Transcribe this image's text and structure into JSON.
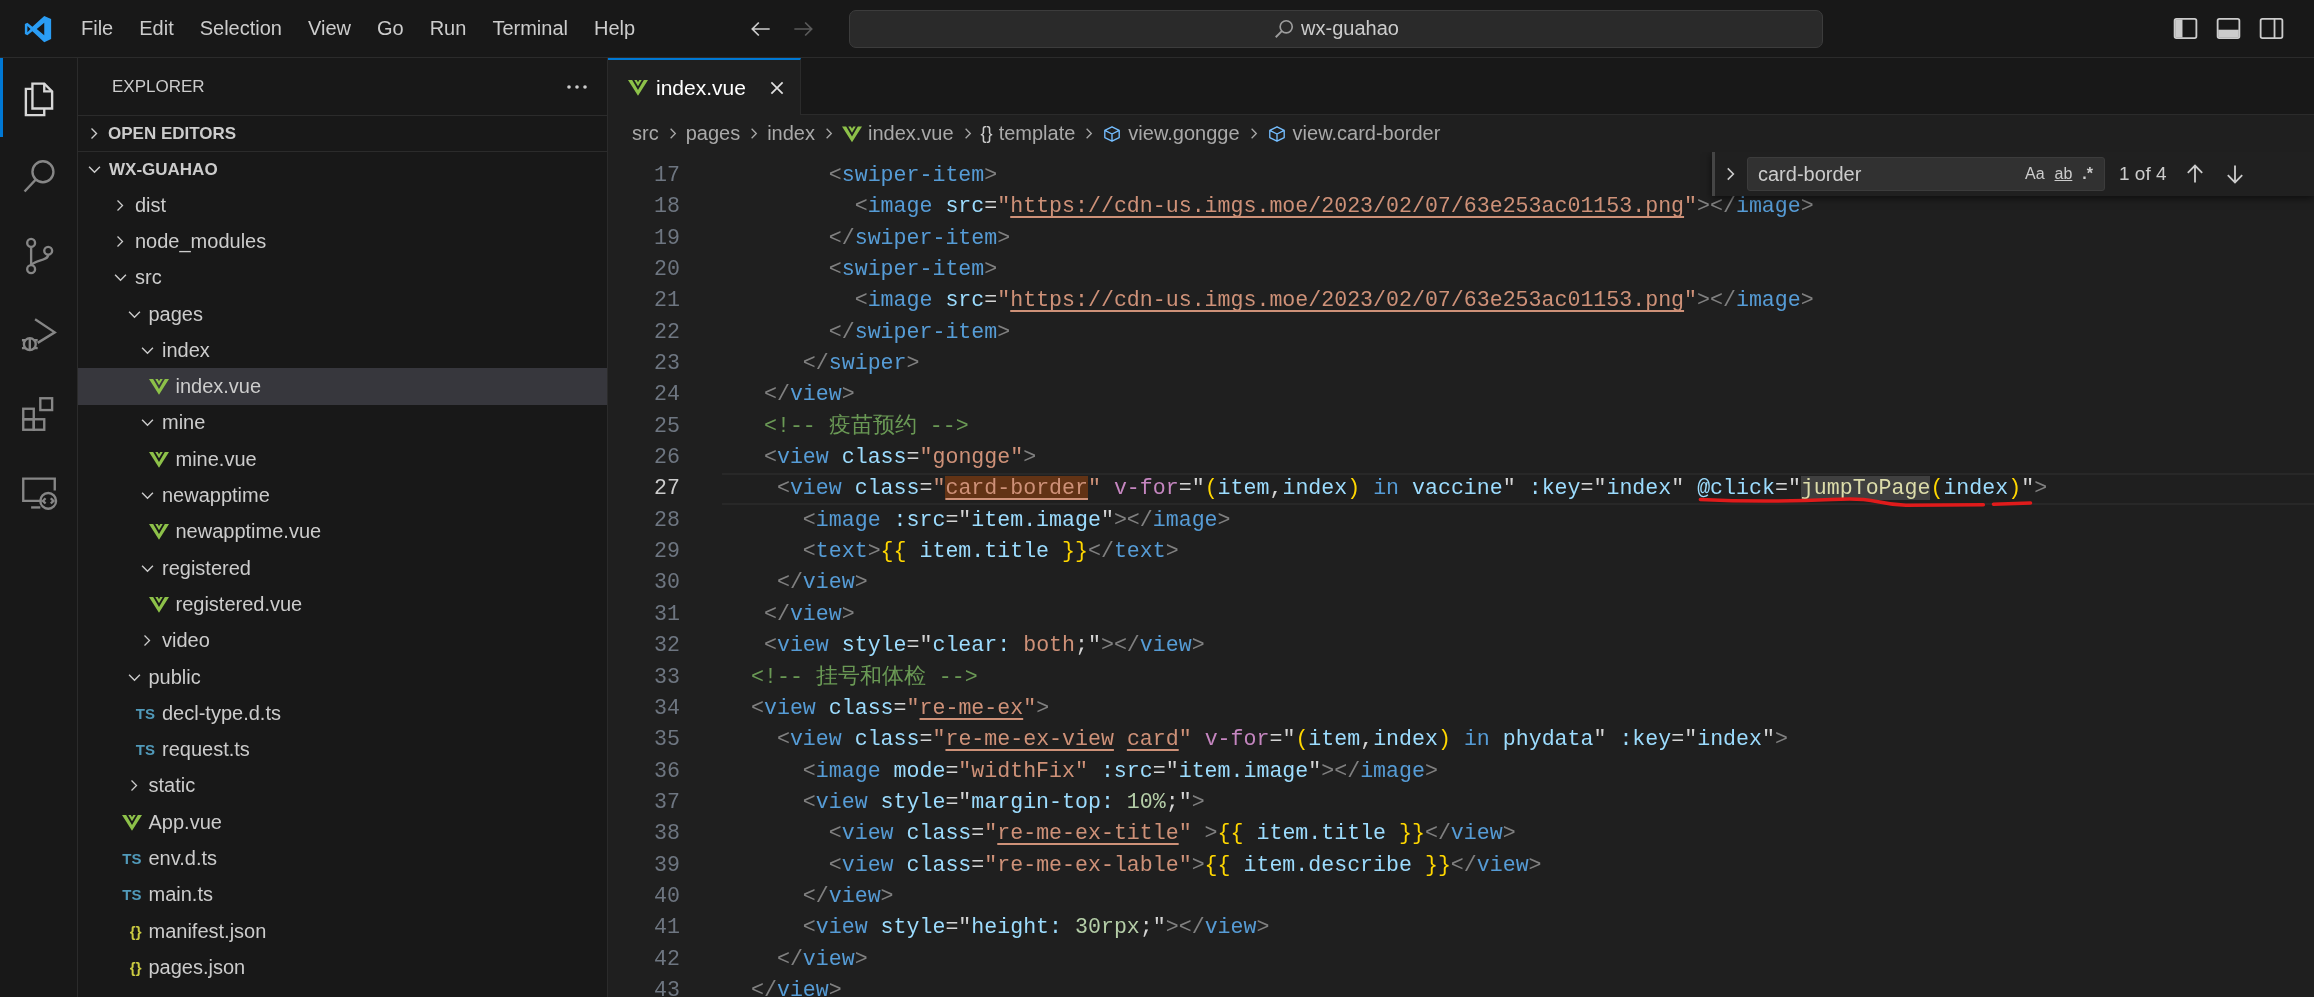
{
  "title_bar": {
    "menu": [
      "File",
      "Edit",
      "Selection",
      "View",
      "Go",
      "Run",
      "Terminal",
      "Help"
    ],
    "nav": [
      {
        "kind": "back",
        "disabled": false
      },
      {
        "kind": "forward",
        "disabled": true
      }
    ],
    "command_center": "wx-guahao",
    "layout": [
      {
        "kind": "primary-sidebar",
        "on": true
      },
      {
        "kind": "panel",
        "on": true
      },
      {
        "kind": "secondary-sidebar",
        "on": false
      }
    ]
  },
  "activity_bar": [
    {
      "kind": "files",
      "selected": true
    },
    {
      "kind": "search",
      "selected": false
    },
    {
      "kind": "source-control",
      "selected": false
    },
    {
      "kind": "run-debug",
      "selected": false
    },
    {
      "kind": "extensions",
      "selected": false
    },
    {
      "kind": "remote",
      "selected": false
    }
  ],
  "explorer": {
    "title": "EXPLORER",
    "sections": [
      {
        "title": "OPEN EDITORS",
        "expanded": false
      },
      {
        "title": "WX-GUAHAO",
        "expanded": true,
        "children": [
          {
            "name": "dist",
            "kind": "folder",
            "expanded": false,
            "selected": false
          },
          {
            "name": "node_modules",
            "kind": "folder",
            "expanded": false,
            "selected": false
          },
          {
            "name": "src",
            "kind": "folder",
            "expanded": true,
            "selected": false,
            "children": [
              {
                "name": "pages",
                "kind": "folder",
                "expanded": true,
                "selected": false,
                "children": [
                  {
                    "name": "index",
                    "kind": "folder",
                    "expanded": true,
                    "selected": false,
                    "children": [
                      {
                        "name": "index.vue",
                        "kind": "vue",
                        "selected": true
                      }
                    ]
                  },
                  {
                    "name": "mine",
                    "kind": "folder",
                    "expanded": true,
                    "selected": false,
                    "children": [
                      {
                        "name": "mine.vue",
                        "kind": "vue",
                        "selected": false
                      }
                    ]
                  },
                  {
                    "name": "newapptime",
                    "kind": "folder",
                    "expanded": true,
                    "selected": false,
                    "children": [
                      {
                        "name": "newapptime.vue",
                        "kind": "vue",
                        "selected": false
                      }
                    ]
                  },
                  {
                    "name": "registered",
                    "kind": "folder",
                    "expanded": true,
                    "selected": false,
                    "children": [
                      {
                        "name": "registered.vue",
                        "kind": "vue",
                        "selected": false
                      }
                    ]
                  },
                  {
                    "name": "video",
                    "kind": "folder",
                    "expanded": false,
                    "selected": false
                  }
                ]
              },
              {
                "name": "public",
                "kind": "folder",
                "expanded": true,
                "selected": false,
                "children": [
                  {
                    "name": "decl-type.d.ts",
                    "kind": "ts",
                    "badge": "TS",
                    "selected": false
                  },
                  {
                    "name": "request.ts",
                    "kind": "ts",
                    "badge": "TS",
                    "selected": false
                  }
                ]
              },
              {
                "name": "static",
                "kind": "folder",
                "expanded": false,
                "selected": false
              },
              {
                "name": "App.vue",
                "kind": "vue",
                "selected": false
              },
              {
                "name": "env.d.ts",
                "kind": "ts",
                "badge": "TS",
                "selected": false
              },
              {
                "name": "main.ts",
                "kind": "ts",
                "badge": "TS",
                "selected": false
              },
              {
                "name": "manifest.json",
                "kind": "json",
                "badge": "{}",
                "selected": false
              },
              {
                "name": "pages.json",
                "kind": "json",
                "badge": "{}",
                "selected": false
              }
            ]
          }
        ]
      }
    ]
  },
  "tabs": [
    {
      "title": "index.vue",
      "kind": "vue",
      "selected": true
    }
  ],
  "breadcrumbs": [
    {
      "text": "src",
      "kind": "folder"
    },
    {
      "text": "pages",
      "kind": "folder"
    },
    {
      "text": "index",
      "kind": "folder"
    },
    {
      "text": "index.vue",
      "kind": "vue"
    },
    {
      "text": "template",
      "kind": "braces",
      "badge": "{}"
    },
    {
      "text": "view.gongge",
      "kind": "element"
    },
    {
      "text": "view.card-border",
      "kind": "element"
    }
  ],
  "find": {
    "replace_expanded": false,
    "value": "card-border",
    "options": [
      {
        "kind": "case",
        "label": "Aa",
        "on": false
      },
      {
        "kind": "word",
        "label": "ab",
        "on": false
      },
      {
        "kind": "regex",
        "label": ".*",
        "on": false
      }
    ],
    "count": "1 of 4"
  },
  "code": {
    "lines": [
      {
        "number": "17",
        "current": false,
        "tokens": [
          {
            "kind": "punct",
            "text": "      <"
          },
          {
            "kind": "tag",
            "text": "swiper-item"
          },
          {
            "kind": "punct",
            "text": ">"
          }
        ]
      },
      {
        "number": "18",
        "current": false,
        "tokens": [
          {
            "kind": "punct",
            "text": "        <"
          },
          {
            "kind": "tag",
            "text": "image"
          },
          {
            "kind": "attr",
            "text": " src"
          },
          {
            "kind": "op",
            "text": "="
          },
          {
            "kind": "str",
            "text": "\""
          },
          {
            "kind": "str",
            "text": "https://cdn-us.imgs.moe/2023/02/07/63e253ac01153.png",
            "underlined": true
          },
          {
            "kind": "str",
            "text": "\""
          },
          {
            "kind": "punct",
            "text": "></"
          },
          {
            "kind": "tag",
            "text": "image"
          },
          {
            "kind": "punct",
            "text": ">"
          }
        ]
      },
      {
        "number": "19",
        "current": false,
        "tokens": [
          {
            "kind": "punct",
            "text": "      </"
          },
          {
            "kind": "tag",
            "text": "swiper-item"
          },
          {
            "kind": "punct",
            "text": ">"
          }
        ]
      },
      {
        "number": "20",
        "current": false,
        "tokens": [
          {
            "kind": "punct",
            "text": "      <"
          },
          {
            "kind": "tag",
            "text": "swiper-item"
          },
          {
            "kind": "punct",
            "text": ">"
          }
        ]
      },
      {
        "number": "21",
        "current": false,
        "tokens": [
          {
            "kind": "punct",
            "text": "        <"
          },
          {
            "kind": "tag",
            "text": "image"
          },
          {
            "kind": "attr",
            "text": " src"
          },
          {
            "kind": "op",
            "text": "="
          },
          {
            "kind": "str",
            "text": "\""
          },
          {
            "kind": "str",
            "text": "https://cdn-us.imgs.moe/2023/02/07/63e253ac01153.png",
            "underlined": true
          },
          {
            "kind": "str",
            "text": "\""
          },
          {
            "kind": "punct",
            "text": "></"
          },
          {
            "kind": "tag",
            "text": "image"
          },
          {
            "kind": "punct",
            "text": ">"
          }
        ]
      },
      {
        "number": "22",
        "current": false,
        "tokens": [
          {
            "kind": "punct",
            "text": "      </"
          },
          {
            "kind": "tag",
            "text": "swiper-item"
          },
          {
            "kind": "punct",
            "text": ">"
          }
        ]
      },
      {
        "number": "23",
        "current": false,
        "tokens": [
          {
            "kind": "punct",
            "text": "    </"
          },
          {
            "kind": "tag",
            "text": "swiper"
          },
          {
            "kind": "punct",
            "text": ">"
          }
        ]
      },
      {
        "number": "24",
        "current": false,
        "tokens": [
          {
            "kind": "punct",
            "text": " </"
          },
          {
            "kind": "tag",
            "text": "view"
          },
          {
            "kind": "punct",
            "text": ">"
          }
        ]
      },
      {
        "number": "25",
        "current": false,
        "tokens": [
          {
            "kind": "comment",
            "text": " <!-- 疫苗预约 -->"
          }
        ]
      },
      {
        "number": "26",
        "current": false,
        "tokens": [
          {
            "kind": "punct",
            "text": " <"
          },
          {
            "kind": "tag",
            "text": "view"
          },
          {
            "kind": "attr",
            "text": " class"
          },
          {
            "kind": "op",
            "text": "="
          },
          {
            "kind": "str",
            "text": "\"gongge\""
          },
          {
            "kind": "punct",
            "text": ">"
          }
        ]
      },
      {
        "number": "27",
        "current": true,
        "tokens": [
          {
            "kind": "punct",
            "text": "  <"
          },
          {
            "kind": "tag",
            "text": "view"
          },
          {
            "kind": "attr",
            "text": " class"
          },
          {
            "kind": "op",
            "text": "="
          },
          {
            "kind": "str",
            "text": "\""
          },
          {
            "kind": "str",
            "text": "card-border",
            "underlined": true,
            "find_match": true
          },
          {
            "kind": "str",
            "text": "\""
          },
          {
            "kind": "dir",
            "text": " v-for"
          },
          {
            "kind": "op",
            "text": "=\""
          },
          {
            "kind": "brace",
            "text": "("
          },
          {
            "kind": "var",
            "text": "item"
          },
          {
            "kind": "op",
            "text": ","
          },
          {
            "kind": "var",
            "text": "index"
          },
          {
            "kind": "brace",
            "text": ")"
          },
          {
            "kind": "kw",
            "text": " in"
          },
          {
            "kind": "var",
            "text": " vaccine"
          },
          {
            "kind": "op",
            "text": "\""
          },
          {
            "kind": "attr",
            "text": " :key"
          },
          {
            "kind": "op",
            "text": "=\""
          },
          {
            "kind": "var",
            "text": "index"
          },
          {
            "kind": "op",
            "text": "\" "
          },
          {
            "kind": "attr",
            "text": "@click",
            "scribbled": true
          },
          {
            "kind": "op",
            "text": "=\"",
            "scribbled": true
          },
          {
            "kind": "fn",
            "text": "jumpToPage",
            "word_highlight": true,
            "scribbled": true
          },
          {
            "kind": "brace",
            "text": "(",
            "scribbled": true
          },
          {
            "kind": "var",
            "text": "index",
            "scribbled": true
          },
          {
            "kind": "brace",
            "text": ")",
            "scribbled": true
          },
          {
            "kind": "op",
            "text": "\""
          },
          {
            "kind": "punct",
            "text": ">"
          }
        ]
      },
      {
        "number": "28",
        "current": false,
        "tokens": [
          {
            "kind": "punct",
            "text": "    <"
          },
          {
            "kind": "tag",
            "text": "image"
          },
          {
            "kind": "attr",
            "text": " :src"
          },
          {
            "kind": "op",
            "text": "=\""
          },
          {
            "kind": "var",
            "text": "item.image"
          },
          {
            "kind": "op",
            "text": "\""
          },
          {
            "kind": "punct",
            "text": "></"
          },
          {
            "kind": "tag",
            "text": "image"
          },
          {
            "kind": "punct",
            "text": ">"
          }
        ]
      },
      {
        "number": "29",
        "current": false,
        "tokens": [
          {
            "kind": "punct",
            "text": "    <"
          },
          {
            "kind": "tag",
            "text": "text"
          },
          {
            "kind": "punct",
            "text": ">"
          },
          {
            "kind": "brace",
            "text": "{{"
          },
          {
            "kind": "var",
            "text": " item.title "
          },
          {
            "kind": "brace",
            "text": "}}"
          },
          {
            "kind": "punct",
            "text": "</"
          },
          {
            "kind": "tag",
            "text": "text"
          },
          {
            "kind": "punct",
            "text": ">"
          }
        ]
      },
      {
        "number": "30",
        "current": false,
        "tokens": [
          {
            "kind": "punct",
            "text": "  </"
          },
          {
            "kind": "tag",
            "text": "view"
          },
          {
            "kind": "punct",
            "text": ">"
          }
        ]
      },
      {
        "number": "31",
        "current": false,
        "tokens": [
          {
            "kind": "punct",
            "text": " </"
          },
          {
            "kind": "tag",
            "text": "view"
          },
          {
            "kind": "punct",
            "text": ">"
          }
        ]
      },
      {
        "number": "32",
        "current": false,
        "tokens": [
          {
            "kind": "punct",
            "text": " <"
          },
          {
            "kind": "tag",
            "text": "view"
          },
          {
            "kind": "attr",
            "text": " style"
          },
          {
            "kind": "op",
            "text": "=\""
          },
          {
            "kind": "attr",
            "text": "clear:"
          },
          {
            "kind": "str",
            "text": " both"
          },
          {
            "kind": "op",
            "text": ";\""
          },
          {
            "kind": "punct",
            "text": "></"
          },
          {
            "kind": "tag",
            "text": "view"
          },
          {
            "kind": "punct",
            "text": ">"
          }
        ]
      },
      {
        "number": "33",
        "current": false,
        "tokens": [
          {
            "kind": "comment",
            "text": "<!-- 挂号和体检 -->"
          }
        ]
      },
      {
        "number": "34",
        "current": false,
        "tokens": [
          {
            "kind": "punct",
            "text": "<"
          },
          {
            "kind": "tag",
            "text": "view"
          },
          {
            "kind": "attr",
            "text": " class"
          },
          {
            "kind": "op",
            "text": "="
          },
          {
            "kind": "str",
            "text": "\""
          },
          {
            "kind": "str",
            "text": "re-me-ex",
            "underlined": true
          },
          {
            "kind": "str",
            "text": "\""
          },
          {
            "kind": "punct",
            "text": ">"
          }
        ]
      },
      {
        "number": "35",
        "current": false,
        "tokens": [
          {
            "kind": "punct",
            "text": "  <"
          },
          {
            "kind": "tag",
            "text": "view"
          },
          {
            "kind": "attr",
            "text": " class"
          },
          {
            "kind": "op",
            "text": "="
          },
          {
            "kind": "str",
            "text": "\""
          },
          {
            "kind": "str",
            "text": "re-me-ex-view",
            "underlined": true
          },
          {
            "kind": "str",
            "text": " card",
            "underlined": true
          },
          {
            "kind": "str",
            "text": "\""
          },
          {
            "kind": "dir",
            "text": " v-for"
          },
          {
            "kind": "op",
            "text": "=\""
          },
          {
            "kind": "brace",
            "text": "("
          },
          {
            "kind": "var",
            "text": "item"
          },
          {
            "kind": "op",
            "text": ","
          },
          {
            "kind": "var",
            "text": "index"
          },
          {
            "kind": "brace",
            "text": ")"
          },
          {
            "kind": "kw",
            "text": " in"
          },
          {
            "kind": "var",
            "text": " phydata"
          },
          {
            "kind": "op",
            "text": "\""
          },
          {
            "kind": "attr",
            "text": " :key"
          },
          {
            "kind": "op",
            "text": "=\""
          },
          {
            "kind": "var",
            "text": "index"
          },
          {
            "kind": "op",
            "text": "\""
          },
          {
            "kind": "punct",
            "text": ">"
          }
        ]
      },
      {
        "number": "36",
        "current": false,
        "tokens": [
          {
            "kind": "punct",
            "text": "    <"
          },
          {
            "kind": "tag",
            "text": "image"
          },
          {
            "kind": "attr",
            "text": " mode"
          },
          {
            "kind": "op",
            "text": "="
          },
          {
            "kind": "str",
            "text": "\"widthFix\""
          },
          {
            "kind": "attr",
            "text": " :src"
          },
          {
            "kind": "op",
            "text": "=\""
          },
          {
            "kind": "var",
            "text": "item.image"
          },
          {
            "kind": "op",
            "text": "\""
          },
          {
            "kind": "punct",
            "text": "></"
          },
          {
            "kind": "tag",
            "text": "image"
          },
          {
            "kind": "punct",
            "text": ">"
          }
        ]
      },
      {
        "number": "37",
        "current": false,
        "tokens": [
          {
            "kind": "punct",
            "text": "    <"
          },
          {
            "kind": "tag",
            "text": "view"
          },
          {
            "kind": "attr",
            "text": " style"
          },
          {
            "kind": "op",
            "text": "=\""
          },
          {
            "kind": "attr",
            "text": "margin-top:"
          },
          {
            "kind": "num",
            "text": " 10%"
          },
          {
            "kind": "op",
            "text": ";\""
          },
          {
            "kind": "punct",
            "text": ">"
          }
        ]
      },
      {
        "number": "38",
        "current": false,
        "tokens": [
          {
            "kind": "punct",
            "text": "      <"
          },
          {
            "kind": "tag",
            "text": "view"
          },
          {
            "kind": "attr",
            "text": " class"
          },
          {
            "kind": "op",
            "text": "="
          },
          {
            "kind": "str",
            "text": "\""
          },
          {
            "kind": "str",
            "text": "re-me-ex-title",
            "underlined": true
          },
          {
            "kind": "str",
            "text": "\""
          },
          {
            "kind": "punct",
            "text": " >"
          },
          {
            "kind": "brace",
            "text": "{{"
          },
          {
            "kind": "var",
            "text": " item.title "
          },
          {
            "kind": "brace",
            "text": "}}"
          },
          {
            "kind": "punct",
            "text": "</"
          },
          {
            "kind": "tag",
            "text": "view"
          },
          {
            "kind": "punct",
            "text": ">"
          }
        ]
      },
      {
        "number": "39",
        "current": false,
        "tokens": [
          {
            "kind": "punct",
            "text": "      <"
          },
          {
            "kind": "tag",
            "text": "view"
          },
          {
            "kind": "attr",
            "text": " class"
          },
          {
            "kind": "op",
            "text": "="
          },
          {
            "kind": "str",
            "text": "\"re-me-ex-lable\""
          },
          {
            "kind": "punct",
            "text": ">"
          },
          {
            "kind": "brace",
            "text": "{{"
          },
          {
            "kind": "var",
            "text": " item.describe "
          },
          {
            "kind": "brace",
            "text": "}}"
          },
          {
            "kind": "punct",
            "text": "</"
          },
          {
            "kind": "tag",
            "text": "view"
          },
          {
            "kind": "punct",
            "text": ">"
          }
        ]
      },
      {
        "number": "40",
        "current": false,
        "tokens": [
          {
            "kind": "punct",
            "text": "    </"
          },
          {
            "kind": "tag",
            "text": "view"
          },
          {
            "kind": "punct",
            "text": ">"
          }
        ]
      },
      {
        "number": "41",
        "current": false,
        "tokens": [
          {
            "kind": "punct",
            "text": "    <"
          },
          {
            "kind": "tag",
            "text": "view"
          },
          {
            "kind": "attr",
            "text": " style"
          },
          {
            "kind": "op",
            "text": "=\""
          },
          {
            "kind": "attr",
            "text": "height:"
          },
          {
            "kind": "num",
            "text": " 30rpx"
          },
          {
            "kind": "op",
            "text": ";\""
          },
          {
            "kind": "punct",
            "text": "></"
          },
          {
            "kind": "tag",
            "text": "view"
          },
          {
            "kind": "punct",
            "text": ">"
          }
        ]
      },
      {
        "number": "42",
        "current": false,
        "tokens": [
          {
            "kind": "punct",
            "text": "  </"
          },
          {
            "kind": "tag",
            "text": "view"
          },
          {
            "kind": "punct",
            "text": ">"
          }
        ]
      },
      {
        "number": "43",
        "current": false,
        "tokens": [
          {
            "kind": "punct",
            "text": "</"
          },
          {
            "kind": "tag",
            "text": "view"
          },
          {
            "kind": "punct",
            "text": ">"
          }
        ]
      }
    ]
  }
}
